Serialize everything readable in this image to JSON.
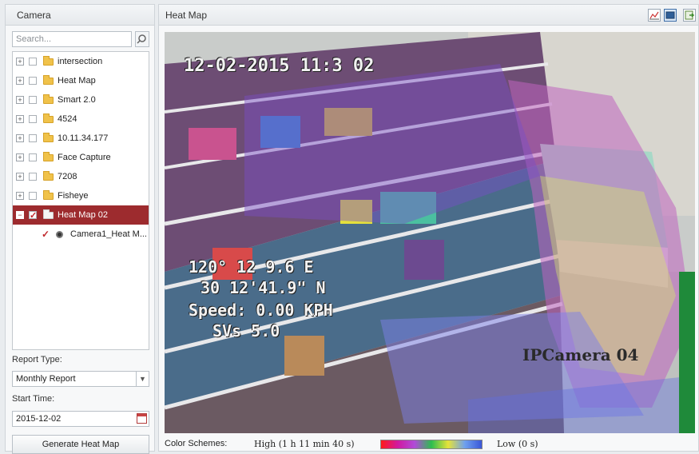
{
  "left_panel": {
    "title": "Camera",
    "search": {
      "placeholder": "Search..."
    },
    "tree": [
      {
        "label": "intersection",
        "expander": "+"
      },
      {
        "label": "Heat Map",
        "expander": "+"
      },
      {
        "label": "Smart 2.0",
        "expander": "+"
      },
      {
        "label": "4524",
        "expander": "+"
      },
      {
        "label": "10.11.34.177",
        "expander": "+"
      },
      {
        "label": "Face Capture",
        "expander": "+"
      },
      {
        "label": "7208",
        "expander": "+"
      },
      {
        "label": "Fisheye",
        "expander": "+"
      },
      {
        "label": "Heat Map 02",
        "expander": "−",
        "selected": true,
        "checked": true
      }
    ],
    "child_camera": {
      "label": "Camera1_Heat M...",
      "checked": true
    },
    "report_type_label": "Report Type:",
    "report_type_value": "Monthly Report",
    "start_time_label": "Start Time:",
    "start_time_value": "2015-12-02",
    "generate_button": "Generate Heat Map"
  },
  "right_panel": {
    "title": "Heat Map",
    "overlay": {
      "timestamp": "12-02-2015 11:3  02",
      "gps_line1": "120° 12  9.6  E",
      "gps_line2": "30  12'41.9\" N",
      "speed": "Speed: 0.00 KPH",
      "svs": "SVs   5.0",
      "camera_name": "IPCamera 04"
    },
    "color_schemes_label": "Color Schemes:",
    "high_label": "High (1 h 11 min 40 s)",
    "low_label": "Low (0 s)"
  },
  "colors": {
    "selected_row": "#9d2b2e",
    "gradient": [
      "#ff1a1a",
      "#d01aa0",
      "#b04bd8",
      "#2dbd4f",
      "#e6e23a",
      "#6ea0ee",
      "#3a57d8"
    ]
  },
  "icons": [
    "search-icon",
    "folder-icon",
    "camera-icon",
    "calendar-icon",
    "chevron-down-icon",
    "chart-icon",
    "window-icon",
    "export-icon"
  ]
}
